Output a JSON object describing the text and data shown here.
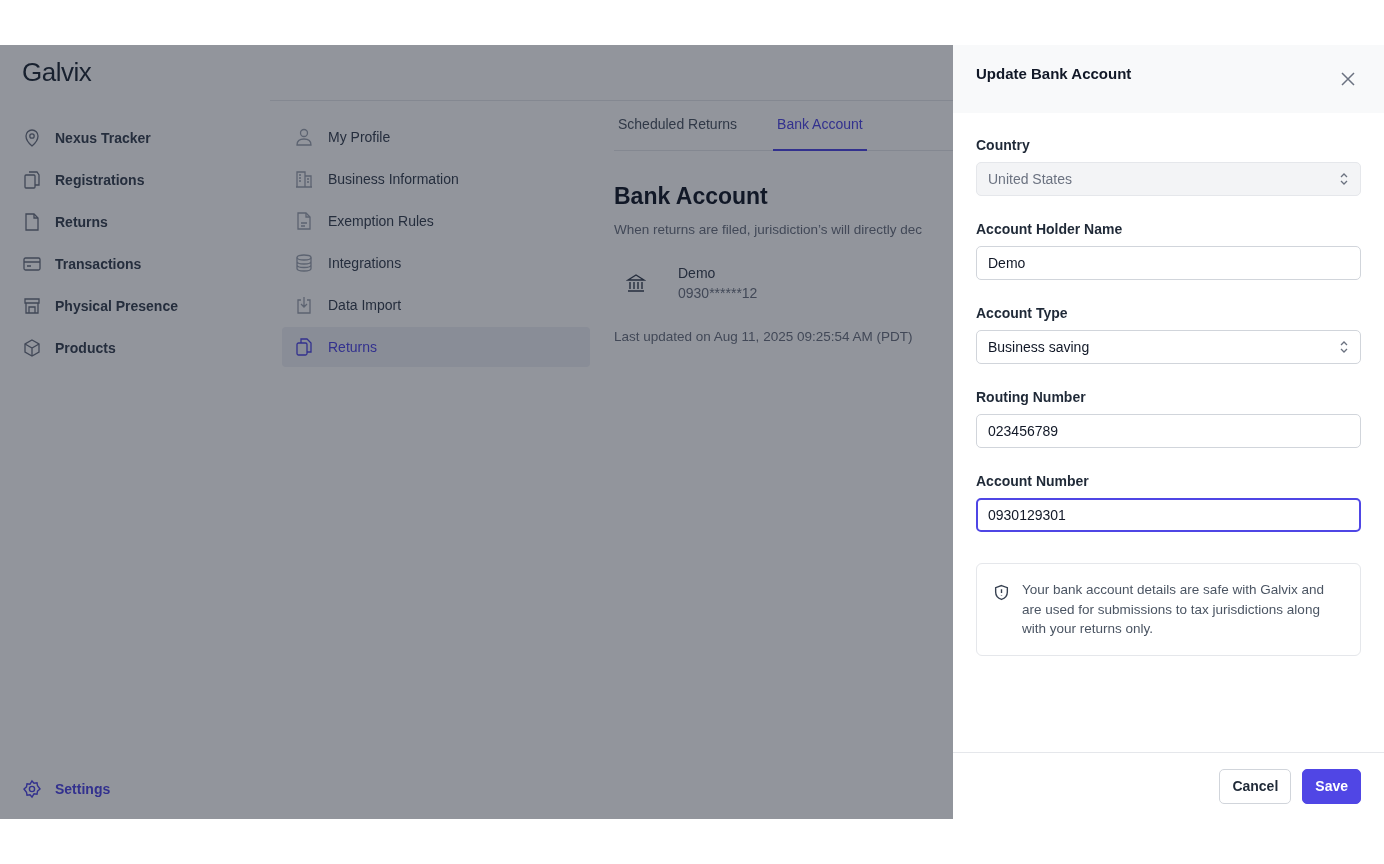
{
  "app": {
    "logo": "Galvix"
  },
  "sidebar": {
    "items": [
      {
        "label": "Nexus Tracker",
        "selected": false
      },
      {
        "label": "Registrations",
        "selected": false
      },
      {
        "label": "Returns",
        "selected": false
      },
      {
        "label": "Transactions",
        "selected": false
      },
      {
        "label": "Physical Presence",
        "selected": false
      },
      {
        "label": "Products",
        "selected": false
      }
    ],
    "footer_item": {
      "label": "Settings",
      "selected": true
    }
  },
  "settings_nav": {
    "items": [
      {
        "label": "My Profile",
        "selected": false
      },
      {
        "label": "Business Information",
        "selected": false
      },
      {
        "label": "Exemption Rules",
        "selected": false
      },
      {
        "label": "Integrations",
        "selected": false
      },
      {
        "label": "Data Import",
        "selected": false
      },
      {
        "label": "Returns",
        "selected": true
      }
    ]
  },
  "tabs": [
    {
      "label": "Scheduled Returns",
      "selected": false
    },
    {
      "label": "Bank Account",
      "selected": true
    }
  ],
  "content": {
    "title": "Bank Account",
    "description": "When returns are filed, jurisdiction’s will directly dec",
    "account": {
      "name": "Demo",
      "number": "0930******12"
    },
    "updated": "Last updated on Aug 11, 2025 09:25:54 AM (PDT)"
  },
  "drawer": {
    "title": "Update Bank Account",
    "fields": [
      {
        "label": "Country",
        "kind": "select",
        "value": "United States",
        "disabled": true,
        "focused": false
      },
      {
        "label": "Account Holder Name",
        "kind": "text",
        "value": "Demo",
        "disabled": false,
        "focused": false
      },
      {
        "label": "Account Type",
        "kind": "select",
        "value": "Business saving",
        "disabled": false,
        "focused": false
      },
      {
        "label": "Routing Number",
        "kind": "text",
        "value": "023456789",
        "disabled": false,
        "focused": false
      },
      {
        "label": "Account Number",
        "kind": "text",
        "value": "0930129301",
        "disabled": false,
        "focused": true
      }
    ],
    "notice": "Your bank account details are safe with Galvix and are used for submissions to tax jurisdictions along with your returns only.",
    "buttons": [
      {
        "label": "Cancel",
        "kind": "secondary"
      },
      {
        "label": "Save",
        "kind": "primary"
      }
    ]
  }
}
